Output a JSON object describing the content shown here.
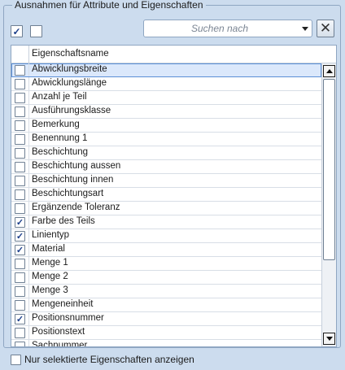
{
  "group_title": "Ausnahmen für Attribute und Eigenschaften",
  "toolbar": {
    "select_all_checked": true,
    "deselect_all_checked": false
  },
  "search": {
    "placeholder": "Suchen nach",
    "clear_icon": "close-icon"
  },
  "table": {
    "column_header": "Eigenschaftsname",
    "rows": [
      {
        "label": "Abwicklungsbreite",
        "checked": false,
        "selected": true
      },
      {
        "label": "Abwicklungslänge",
        "checked": false
      },
      {
        "label": "Anzahl je Teil",
        "checked": false
      },
      {
        "label": "Ausführungsklasse",
        "checked": false
      },
      {
        "label": "Bemerkung",
        "checked": false
      },
      {
        "label": "Benennung 1",
        "checked": false
      },
      {
        "label": "Beschichtung",
        "checked": false
      },
      {
        "label": "Beschichtung aussen",
        "checked": false
      },
      {
        "label": "Beschichtung innen",
        "checked": false
      },
      {
        "label": "Beschichtungsart",
        "checked": false
      },
      {
        "label": "Ergänzende Toleranz",
        "checked": false
      },
      {
        "label": "Farbe des Teils",
        "checked": true
      },
      {
        "label": "Linientyp",
        "checked": true
      },
      {
        "label": "Material",
        "checked": true
      },
      {
        "label": "Menge 1",
        "checked": false
      },
      {
        "label": "Menge 2",
        "checked": false
      },
      {
        "label": "Menge 3",
        "checked": false
      },
      {
        "label": "Mengeneinheit",
        "checked": false
      },
      {
        "label": "Positionsnummer",
        "checked": true
      },
      {
        "label": "Positionstext",
        "checked": false
      },
      {
        "label": "Sachnummer",
        "checked": false
      }
    ]
  },
  "footer": {
    "only_selected_label": "Nur selektierte Eigenschaften anzeigen",
    "only_selected_checked": false
  },
  "colors": {
    "background": "#ccdcee",
    "selection": "#dbe8fb",
    "check": "#1b3e8a"
  }
}
